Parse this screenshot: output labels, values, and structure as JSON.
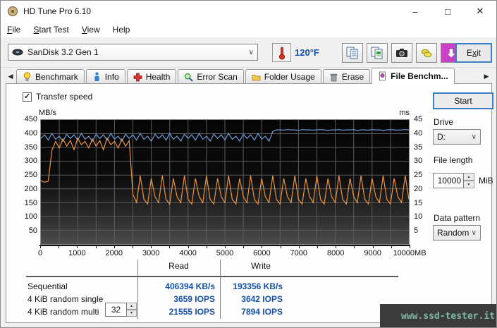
{
  "window": {
    "title": "HD Tune Pro 6.10",
    "controls": {
      "minimize": "–",
      "maximize": "□",
      "close": "✕"
    }
  },
  "menu": {
    "items": [
      {
        "accel": "F",
        "rest": "ile"
      },
      {
        "accel": "S",
        "rest": "tart Test"
      },
      {
        "accel": "V",
        "rest": "iew"
      },
      {
        "accel": "",
        "rest": "Help"
      }
    ]
  },
  "toolbar": {
    "drive_selector_value": "SanDisk 3.2 Gen 1",
    "temperature": "120°F",
    "exit": {
      "pre": "E",
      "accel": "x",
      "rest": "it"
    }
  },
  "tabs": {
    "items": [
      {
        "label": "Benchmark"
      },
      {
        "label": "Info"
      },
      {
        "label": "Health"
      },
      {
        "label": "Error Scan"
      },
      {
        "label": "Folder Usage"
      },
      {
        "label": "Erase"
      },
      {
        "label": "File Benchm..."
      }
    ],
    "active": "File Benchm..."
  },
  "panel": {
    "transfer_speed_label": "Transfer speed",
    "start_label": "Start",
    "drive_label": "Drive",
    "drive_value": "D:",
    "file_length_label": "File length",
    "file_length_value": "10000",
    "file_length_unit": "MiB",
    "data_pattern_label": "Data pattern",
    "data_pattern_value": "Random"
  },
  "results": {
    "read_header": "Read",
    "write_header": "Write",
    "rows": [
      {
        "label": "Sequential",
        "read": "406394 KB/s",
        "write": "193356 KB/s"
      },
      {
        "label": "4 KiB random single",
        "read": "3659 IOPS",
        "write": "3642 IOPS"
      },
      {
        "label": "4 KiB random multi",
        "queue_depth": "32",
        "read": "21555 IOPS",
        "write": "7894 IOPS"
      }
    ]
  },
  "watermark": "www.ssd-tester.it",
  "ui": {
    "chevron": "∨",
    "spin_up": "▲",
    "spin_down": "▼",
    "check": "✓",
    "tab_prev": "◀",
    "tab_next": "▶"
  },
  "colors": {
    "read_line": "#6f9ddb",
    "write_line": "#ec9440",
    "value_text": "#1550a8",
    "grid": "#5c5c5c",
    "watermark_text": "#7fb8aa",
    "download_button": "#cb3fcb"
  },
  "chart_data": {
    "type": "line",
    "title": "Transfer speed",
    "x_max": 10000,
    "x_grid_step": 500,
    "x_ticks": [
      0,
      1000,
      2000,
      3000,
      4000,
      5000,
      6000,
      7000,
      8000,
      9000,
      10000
    ],
    "x_tick_labels": [
      "0",
      "1000",
      "2000",
      "3000",
      "4000",
      "5000",
      "6000",
      "7000",
      "8000",
      "9000",
      "10000MB"
    ],
    "left_axis": {
      "label": "MB/s",
      "min": 0,
      "max": 450,
      "step": 50
    },
    "right_axis": {
      "label": "ms",
      "min": 0,
      "max": 45,
      "step": 5
    },
    "legend": "none",
    "grid": true,
    "series": [
      {
        "name": "read",
        "color": "#6f9ddb",
        "x_start": 0,
        "x_step": 100,
        "values": [
          383,
          396,
          377,
          401,
          380,
          391,
          373,
          398,
          383,
          396,
          377,
          401,
          380,
          391,
          373,
          398,
          383,
          396,
          377,
          401,
          380,
          391,
          373,
          398,
          383,
          396,
          377,
          401,
          380,
          391,
          373,
          398,
          383,
          396,
          377,
          401,
          380,
          391,
          373,
          398,
          383,
          396,
          377,
          401,
          380,
          391,
          373,
          398,
          383,
          396,
          377,
          401,
          380,
          391,
          373,
          398,
          383,
          396,
          377,
          401,
          380,
          391,
          373,
          408,
          414,
          414,
          413,
          415,
          414,
          414,
          412,
          415,
          414,
          414,
          413,
          414,
          415,
          414,
          412,
          414,
          414,
          415,
          413,
          414,
          414,
          415,
          412,
          414,
          414,
          413,
          415,
          414,
          414,
          412,
          414,
          415,
          414,
          413,
          414,
          415,
          414
        ]
      },
      {
        "name": "write",
        "color": "#ec9440",
        "x_start": 0,
        "x_step": 100,
        "values": [
          230,
          224,
          228,
          340,
          372,
          348,
          381,
          355,
          375,
          342,
          384,
          360,
          372,
          348,
          381,
          355,
          375,
          342,
          384,
          360,
          372,
          348,
          381,
          355,
          375,
          180,
          150,
          248,
          162,
          145,
          238,
          172,
          150,
          248,
          162,
          145,
          238,
          172,
          150,
          248,
          162,
          145,
          238,
          172,
          150,
          248,
          162,
          145,
          238,
          172,
          150,
          248,
          162,
          145,
          238,
          172,
          150,
          248,
          162,
          145,
          238,
          172,
          150,
          248,
          162,
          145,
          238,
          172,
          150,
          248,
          162,
          145,
          238,
          172,
          150,
          248,
          162,
          145,
          238,
          172,
          150,
          248,
          162,
          145,
          238,
          172,
          150,
          248,
          162,
          145,
          238,
          172,
          150,
          248,
          162,
          145,
          238,
          172,
          150,
          248,
          162
        ]
      }
    ]
  }
}
